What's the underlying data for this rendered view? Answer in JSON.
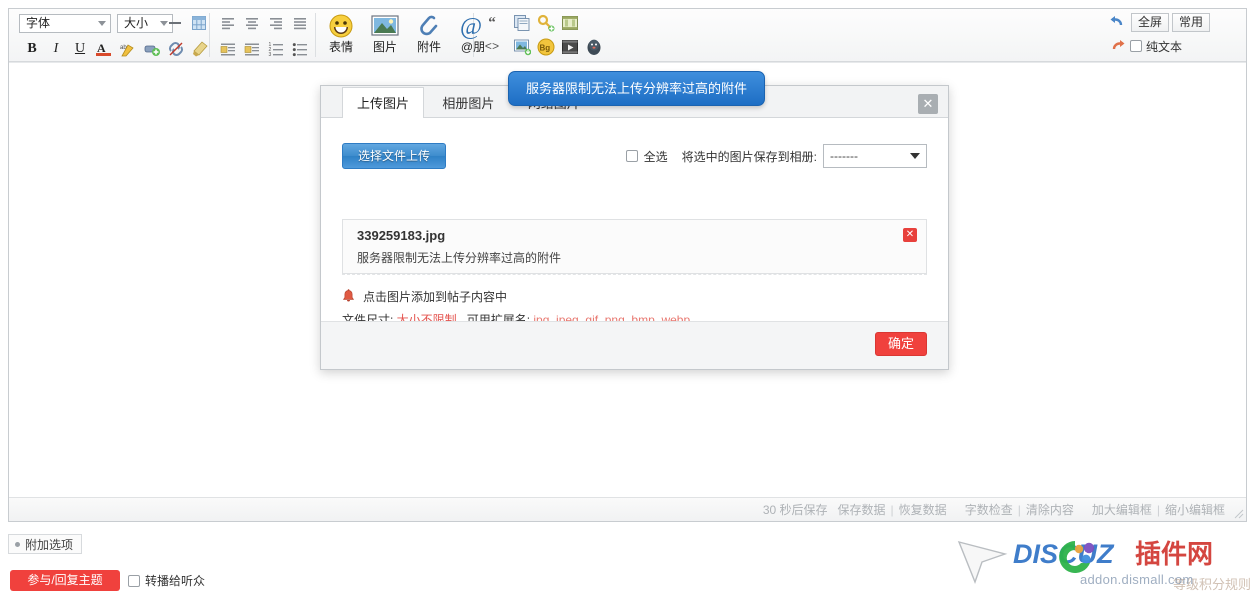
{
  "toolbar": {
    "font_select": {
      "label": "字体",
      "name": "font-family-select"
    },
    "size_select": {
      "label": "大小",
      "name": "font-size-select"
    },
    "icons_row1": [
      {
        "name": "horizontal-rule-icon",
        "title": "横线"
      },
      {
        "name": "table-icon",
        "title": "表格"
      },
      {
        "name": "align-left-icon",
        "title": "左对齐"
      },
      {
        "name": "align-center-icon",
        "title": "居中"
      },
      {
        "name": "align-right-icon",
        "title": "右对齐"
      },
      {
        "name": "align-justify-icon",
        "title": "两端对齐"
      }
    ],
    "icons_row2": [
      {
        "name": "bold-icon",
        "title": "加粗",
        "glyph": "B"
      },
      {
        "name": "italic-icon",
        "title": "斜体",
        "glyph": "I"
      },
      {
        "name": "underline-icon",
        "title": "下划线",
        "glyph": "U"
      },
      {
        "name": "font-color-icon",
        "title": "字体颜色",
        "glyph": "A"
      },
      {
        "name": "highlight-color-icon",
        "title": "背景色"
      },
      {
        "name": "insert-link-icon",
        "title": "插入链接"
      },
      {
        "name": "remove-link-icon",
        "title": "取消链接"
      },
      {
        "name": "clear-format-icon",
        "title": "清除格式"
      },
      {
        "name": "indent-decrease-icon",
        "title": "减少缩进"
      },
      {
        "name": "indent-increase-icon",
        "title": "增加缩进"
      },
      {
        "name": "ordered-list-icon",
        "title": "有序列表"
      },
      {
        "name": "unordered-list-icon",
        "title": "无序列表"
      }
    ],
    "big_buttons": [
      {
        "name": "smiley-button",
        "label": "表情"
      },
      {
        "name": "image-button",
        "label": "图片"
      },
      {
        "name": "attachment-button",
        "label": "附件"
      },
      {
        "name": "mention-button",
        "label": "@朋"
      }
    ],
    "extra_icons": [
      {
        "name": "quote-icon",
        "title": "引用"
      },
      {
        "name": "code-icon",
        "title": "代码"
      },
      {
        "name": "paste-icon",
        "title": "粘贴"
      },
      {
        "name": "key-icon",
        "title": "密码"
      },
      {
        "name": "media-icon",
        "title": "媒体"
      },
      {
        "name": "image-local-icon",
        "title": "本地图片"
      },
      {
        "name": "background-icon",
        "title": "Bg",
        "glyph": "Bg"
      },
      {
        "name": "video-icon",
        "title": "视频"
      },
      {
        "name": "qq-icon",
        "title": "QQ"
      }
    ],
    "right": {
      "undo": {
        "name": "undo-icon",
        "title": "撤销"
      },
      "redo": {
        "name": "redo-icon",
        "title": "重做"
      },
      "fullscreen_label": "全屏",
      "common_label": "常用",
      "plaintext_label": "纯文本",
      "plaintext_checked": false
    }
  },
  "tooltip": {
    "text": "服务器限制无法上传分辨率过高的附件"
  },
  "dialog": {
    "close_label": "✕",
    "tabs": [
      {
        "label": "上传图片",
        "active": true
      },
      {
        "label": "相册图片",
        "active": false
      },
      {
        "label": "网络图片",
        "active": false
      }
    ],
    "upload_button": "选择文件上传",
    "select_all_label": "全选",
    "select_all_checked": false,
    "save_to_album_label": "将选中的图片保存到相册:",
    "album_select_value": "-------",
    "file": {
      "name": "339259183.jpg",
      "message": "服务器限制无法上传分辨率过高的附件",
      "delete_label": "✕"
    },
    "hint_click": "点击图片添加到帖子内容中",
    "hint_size_prefix": "文件尺寸: ",
    "hint_size_value": "大小不限制",
    "hint_ext_prefix": " , 可用扩展名: ",
    "hint_ext_value": "jpg, jpeg, gif, png, bmp, webp",
    "ok_button": "确定"
  },
  "statusbar": {
    "autosave": "30 秒后保存",
    "save_data": "保存数据",
    "restore_data": "恢复数据",
    "word_count": "字数检查",
    "clear_content": "清除内容",
    "enlarge_box": "加大编辑框",
    "shrink_box": "缩小编辑框",
    "separator": "|"
  },
  "bottom": {
    "extra_options": "附加选项",
    "post_button": "参与/回复主题",
    "relay_label": "转播给听众",
    "relay_checked": false
  },
  "watermark": {
    "brand_blue": "DISCUZ",
    "brand_red": "插件网",
    "url": "addon.dismall.com",
    "ghost_text": "等级积分规则",
    "colors": {
      "blue": "#2f72c6",
      "red": "#d0322c",
      "green": "#2eb34a"
    }
  }
}
